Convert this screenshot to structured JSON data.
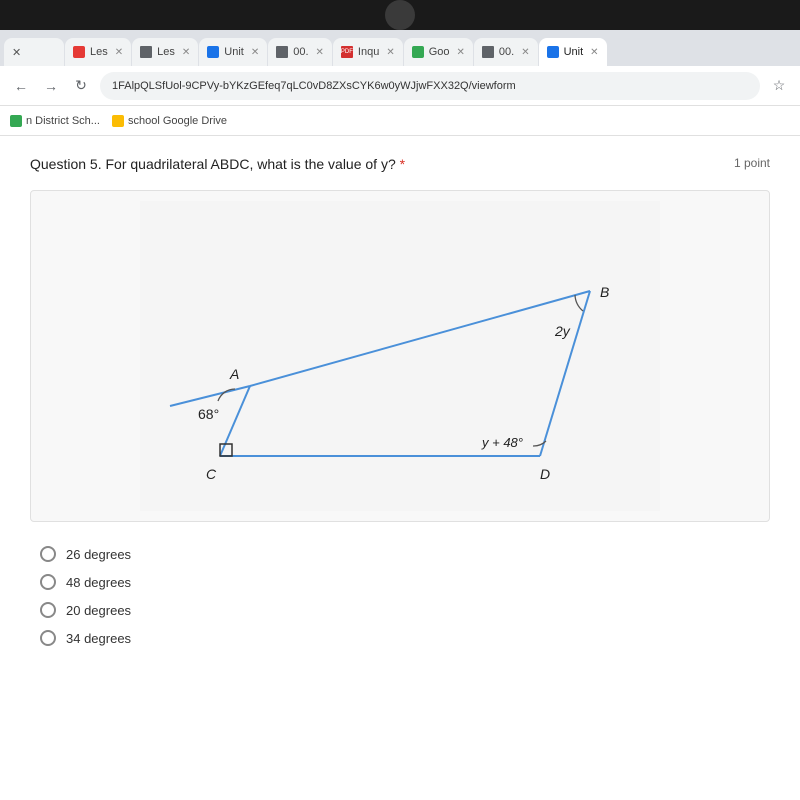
{
  "topBar": {},
  "tabs": [
    {
      "id": "tab1",
      "label": "Les",
      "favicon": "red",
      "active": false
    },
    {
      "id": "tab2",
      "label": "Les",
      "favicon": "icon-box",
      "active": false
    },
    {
      "id": "tab3",
      "label": "Unit",
      "favicon": "blue",
      "active": false
    },
    {
      "id": "tab4",
      "label": "00.",
      "favicon": "icon-box",
      "active": false
    },
    {
      "id": "tab5",
      "label": "Inqu",
      "favicon": "pdf",
      "active": false
    },
    {
      "id": "tab6",
      "label": "Goo",
      "favicon": "green",
      "active": false
    },
    {
      "id": "tab7",
      "label": "00.",
      "favicon": "icon-box",
      "active": false
    },
    {
      "id": "tab8",
      "label": "Unit",
      "favicon": "blue",
      "active": true
    }
  ],
  "addressBar": {
    "url": "1FAlpQLSfUol-9CPVy-bYKzGEfeq7qLC0vD8ZXsCYK6w0yWJjwFXX32Q/viewform"
  },
  "bookmarks": [
    {
      "id": "bm1",
      "label": "n District Sch...",
      "favicon": "green"
    },
    {
      "id": "bm2",
      "label": "school Google Drive",
      "favicon": "yellow"
    }
  ],
  "question": {
    "number": "5",
    "text": "Question 5. For quadrilateral ABDC, what is the value of y?",
    "required_marker": " *",
    "points": "1 point"
  },
  "diagram": {
    "angle_A": "68°",
    "angle_B": "2y",
    "angle_D": "y + 48°",
    "vertex_A": "A",
    "vertex_B": "B",
    "vertex_C": "C",
    "vertex_D": "D"
  },
  "answers": [
    {
      "id": "ans1",
      "label": "26 degrees"
    },
    {
      "id": "ans2",
      "label": "48 degrees"
    },
    {
      "id": "ans3",
      "label": "20 degrees"
    },
    {
      "id": "ans4",
      "label": "34 degrees"
    }
  ]
}
